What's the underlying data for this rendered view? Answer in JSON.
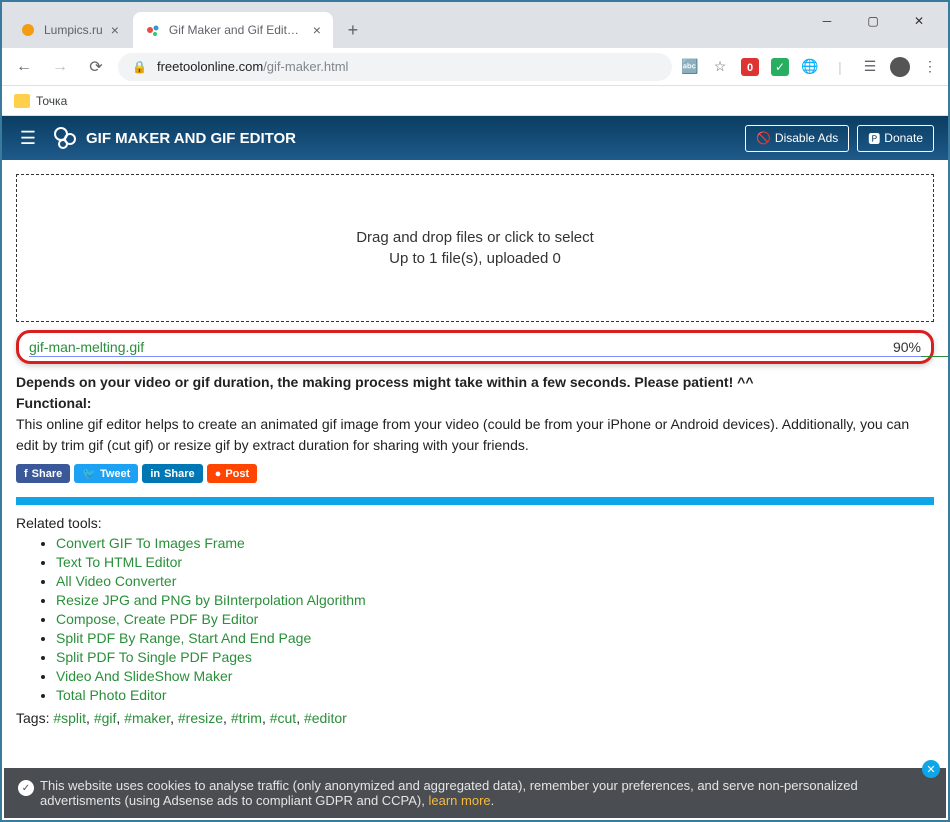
{
  "browser": {
    "tabs": [
      {
        "title": "Lumpics.ru",
        "favicon_color": "#f39c12"
      },
      {
        "title": "Gif Maker and Gif Editor - Free To",
        "favicon_color": "#e74c3c"
      }
    ],
    "url_domain": "freetoolonline.com",
    "url_path": "/gif-maker.html",
    "bookmark_label": "Точка"
  },
  "header": {
    "site_title": "GIF MAKER AND GIF EDITOR",
    "disable_ads": "Disable Ads",
    "donate": "Donate"
  },
  "dropzone": {
    "line1": "Drag and drop files or click to select",
    "line2": "Up to 1 file(s), uploaded 0"
  },
  "upload": {
    "filename": "gif-man-melting.gif",
    "percent": "90%"
  },
  "desc": {
    "line1": "Depends on your video or gif duration, the making process might take within a few seconds. Please patient! ^^",
    "functional_label": "Functional:",
    "line2": "This online gif editor helps to create an animated gif image from your video (could be from your iPhone or Android devices). Additionally, you can edit by trim gif (cut gif) or resize gif by extract duration for sharing with your friends."
  },
  "share": {
    "fb": "Share",
    "tw": "Tweet",
    "li": "Share",
    "rd": "Post"
  },
  "related": {
    "title": "Related tools:",
    "items": [
      "Convert GIF To Images Frame",
      "Text To HTML Editor",
      "All Video Converter",
      "Resize JPG and PNG by BiInterpolation Algorithm",
      "Compose, Create PDF By Editor",
      "Split PDF By Range, Start And End Page",
      "Split PDF To Single PDF Pages",
      "Video And SlideShow Maker",
      "Total Photo Editor"
    ]
  },
  "tags": {
    "label": "Tags: ",
    "items": [
      "#split",
      "#gif",
      "#maker",
      "#resize",
      "#trim",
      "#cut",
      "#editor"
    ]
  },
  "cookie": {
    "text": "This website uses cookies to analyse traffic (only anonymized and aggregated data), remember your preferences, and serve non-personalized advertisments (using Adsense ads to compliant GDPR and CCPA), ",
    "learn": "learn more"
  }
}
